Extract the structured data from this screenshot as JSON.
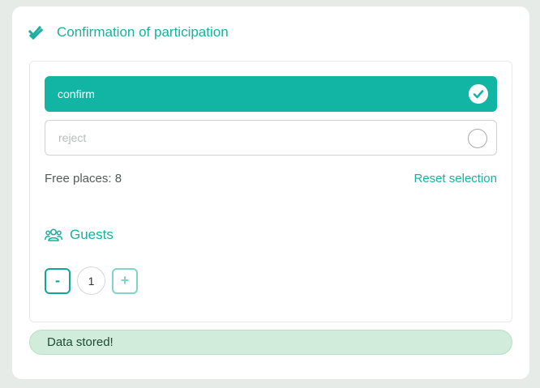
{
  "header": {
    "title": "Confirmation of participation",
    "icon": "double-check-icon"
  },
  "options": {
    "confirm_label": "confirm",
    "reject_label": "reject",
    "selected": "confirm"
  },
  "availability": {
    "free_places_text": "Free places: 8",
    "reset_label": "Reset selection"
  },
  "guests": {
    "label": "Guests",
    "icon": "users-icon",
    "minus_label": "-",
    "plus_label": "+",
    "count": "1"
  },
  "status": {
    "message": "Data stored!"
  },
  "colors": {
    "accent": "#12b5a4",
    "accent_text": "#1aaf9f",
    "success_bg": "#d2ecdb",
    "page_bg": "#e6ebe8"
  }
}
